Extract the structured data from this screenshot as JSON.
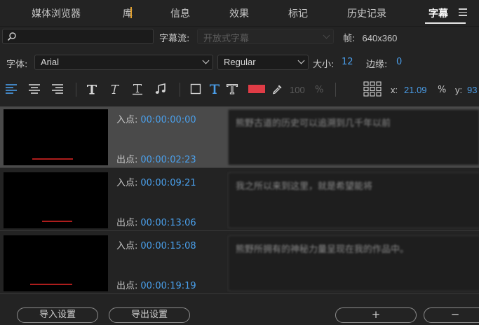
{
  "tabs": [
    {
      "label": "媒体浏览器",
      "active": false
    },
    {
      "label": "库",
      "active": false
    },
    {
      "label": "信息",
      "active": false
    },
    {
      "label": "效果",
      "active": false
    },
    {
      "label": "标记",
      "active": false
    },
    {
      "label": "历史记录",
      "active": false
    },
    {
      "label": "字幕",
      "active": true
    }
  ],
  "search": {
    "placeholder": ""
  },
  "stream": {
    "label": "字幕流:",
    "value": "开放式字幕"
  },
  "frame": {
    "label": "帧:",
    "value": "640x360"
  },
  "font": {
    "label": "字体:",
    "family": "Arial",
    "style": "Regular",
    "size_label": "大小:",
    "size": "12",
    "edge_label": "边缘:",
    "edge": "0"
  },
  "toolbar": {
    "color_hex": "#e03c46",
    "opacity": "100",
    "opacity_unit": "%",
    "x_label": "x:",
    "x_value": "21.09",
    "x_unit": "%",
    "y_label": "y:",
    "y_value": "93"
  },
  "labels": {
    "in": "入点:",
    "out": "出点:"
  },
  "captions": [
    {
      "in": "00:00:00:00",
      "out": "00:00:02:23",
      "text": "熊野古道的历史可以追溯到几千年以前",
      "selected": true
    },
    {
      "in": "00:00:09:21",
      "out": "00:00:13:06",
      "text": "我之所以来到这里，就是希望能将",
      "selected": false
    },
    {
      "in": "00:00:15:08",
      "out": "00:00:19:19",
      "text": "熊野所拥有的神秘力量呈现在我的作品中。",
      "selected": false
    }
  ],
  "buttons": {
    "import": "导入设置",
    "export": "导出设置",
    "add": "+",
    "remove": "−"
  }
}
